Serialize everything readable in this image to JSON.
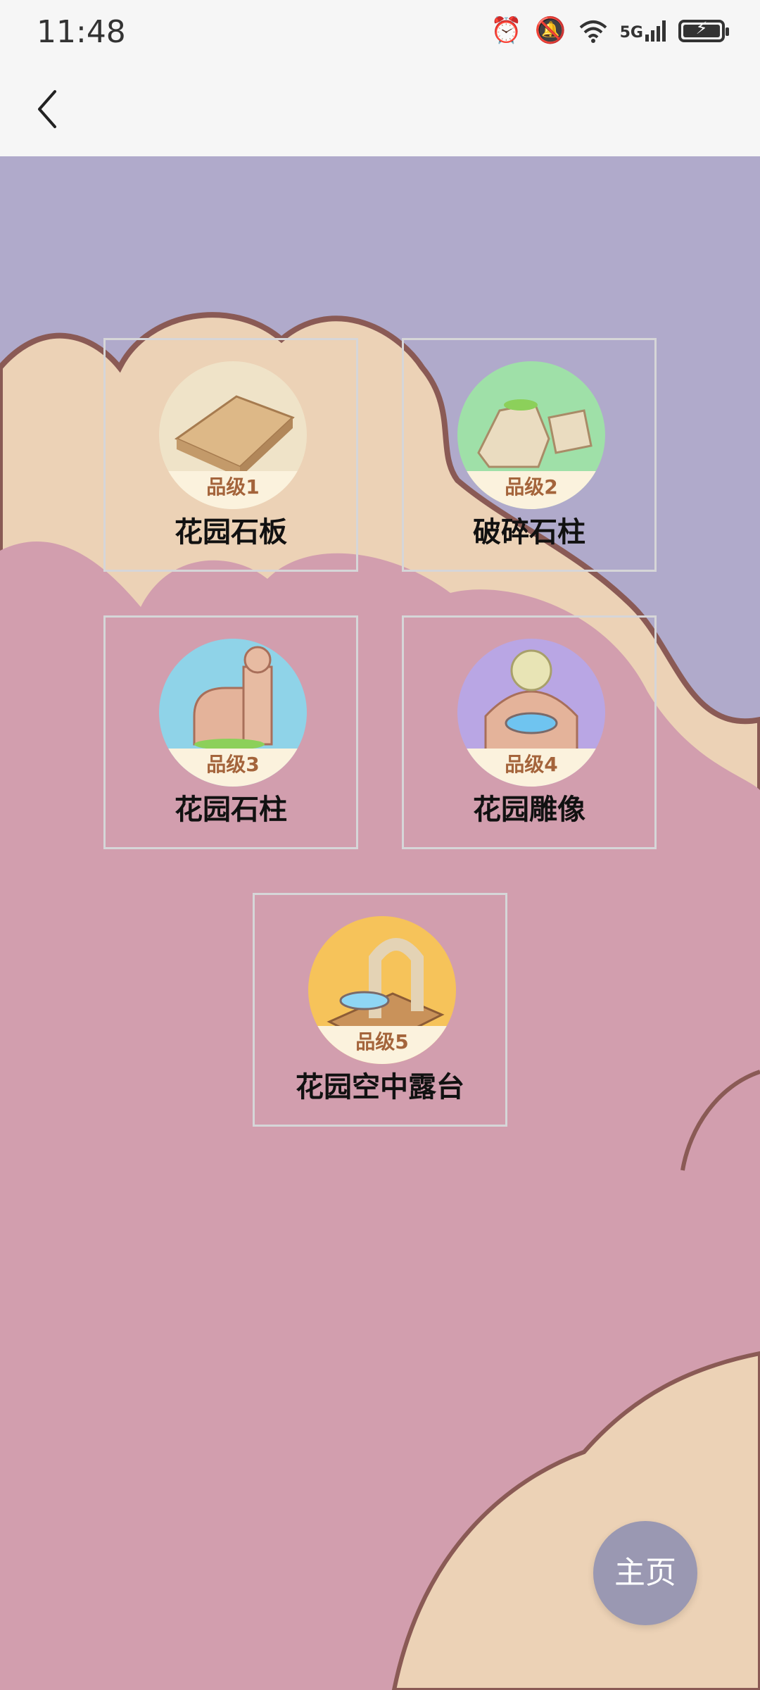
{
  "status_bar": {
    "time": "11:48",
    "network": "5G",
    "icons": [
      "alarm-icon",
      "mute-icon",
      "wifi-icon",
      "signal-icon",
      "battery-icon"
    ]
  },
  "nav": {
    "back_icon": "chevron-left-icon"
  },
  "items": [
    {
      "grade": "品级1",
      "name": "花园石板",
      "badge_color": "#efe3c8"
    },
    {
      "grade": "品级2",
      "name": "破碎石柱",
      "badge_color": "#9fe0a8"
    },
    {
      "grade": "品级3",
      "name": "花园石柱",
      "badge_color": "#8fd3e8"
    },
    {
      "grade": "品级4",
      "name": "花园雕像",
      "badge_color": "#b9a6e4"
    },
    {
      "grade": "品级5",
      "name": "花园空中露台",
      "badge_color": "#f6c35a"
    }
  ],
  "home_button": {
    "label": "主页"
  },
  "colors": {
    "top_bg": "#b0aacb",
    "peach": "#ecd2b6",
    "pink": "#d29eae",
    "outline": "#8a5a55"
  }
}
